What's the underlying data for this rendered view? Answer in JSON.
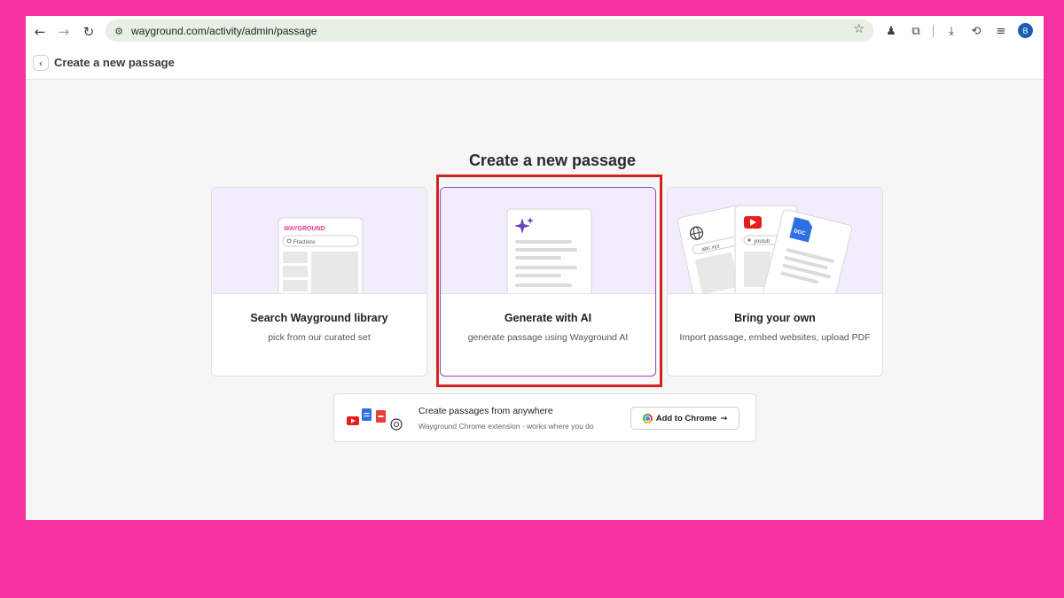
{
  "browser": {
    "url": "wayground.com/activity/admin/passage",
    "icons": [
      "back-arrow-icon",
      "forward-arrow-icon",
      "reload-icon",
      "site-info-icon",
      "star-icon",
      "extension-icon",
      "puzzle-icon",
      "download-icon",
      "performance-icon",
      "media-icon"
    ],
    "avatar_letter": "B"
  },
  "header": {
    "title": "Create a new passage"
  },
  "main": {
    "title": "Create a new passage",
    "cards": [
      {
        "title": "Search Wayground library",
        "subtitle": "pick from our curated set",
        "illustration": {
          "brand": "WAYGROUND",
          "search_text": "Fractions"
        }
      },
      {
        "title": "Generate with AI",
        "subtitle": "generate passage using Wayground AI",
        "selected": true
      },
      {
        "title": "Bring your own",
        "subtitle": "Import passage, embed websites, upload PDF",
        "illustration": {
          "site_text": "abc.xyz",
          "video_text": "youtub",
          "doc_label": "DOC"
        }
      }
    ]
  },
  "extension": {
    "title": "Create passages from anywhere",
    "subtitle": "Wayground Chrome extension - works where you do",
    "button_label": "Add to Chrome",
    "button_arrow": "→"
  },
  "colors": {
    "page_bg": "#f531a0",
    "accent": "#8c4cc5",
    "highlight": "#d1231f",
    "brand": "#e8318f"
  }
}
